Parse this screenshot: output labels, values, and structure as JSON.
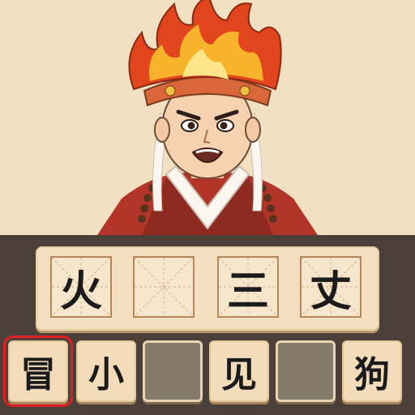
{
  "answer_slots": [
    {
      "char": "火"
    },
    {
      "char": ""
    },
    {
      "char": "三"
    },
    {
      "char": "丈"
    }
  ],
  "choice_tiles": [
    {
      "char": "冒",
      "state": "selected"
    },
    {
      "char": "小",
      "state": "available"
    },
    {
      "char": "",
      "state": "used"
    },
    {
      "char": "见",
      "state": "available"
    },
    {
      "char": "",
      "state": "used"
    },
    {
      "char": "狗",
      "state": "available"
    }
  ],
  "colors": {
    "selection": "#e02020",
    "board": "#4b4039",
    "scene_bg": "#f1e1c2"
  }
}
